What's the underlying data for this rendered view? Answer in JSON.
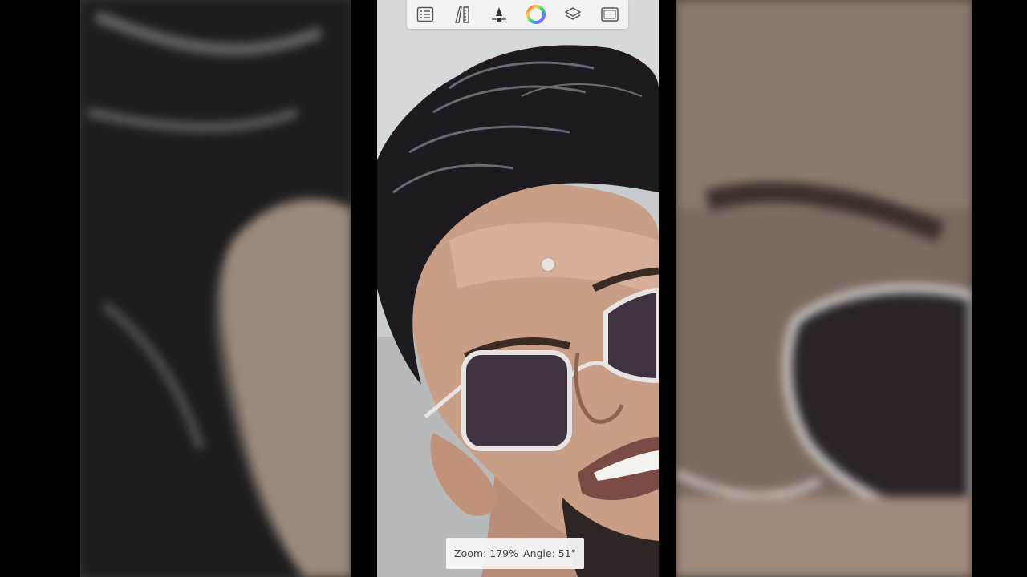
{
  "toolbar": {
    "icons": [
      "list-icon",
      "ruler-pen-icon",
      "brush-icon",
      "color-wheel-icon",
      "layers-icon",
      "canvas-icon"
    ]
  },
  "status": {
    "zoom": "Zoom: 179%",
    "angle": "Angle: 51°"
  },
  "colors": {
    "toolbar_bg": "#f3f3f3",
    "icon": "#555555",
    "backdrop": "#000000"
  }
}
